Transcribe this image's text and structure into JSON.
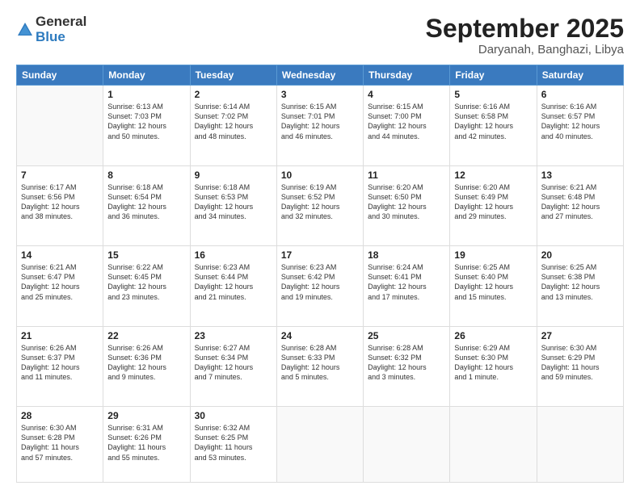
{
  "header": {
    "logo": {
      "general": "General",
      "blue": "Blue"
    },
    "title": "September 2025",
    "location": "Daryanah, Banghazi, Libya"
  },
  "calendar": {
    "weekdays": [
      "Sunday",
      "Monday",
      "Tuesday",
      "Wednesday",
      "Thursday",
      "Friday",
      "Saturday"
    ],
    "weeks": [
      [
        {
          "day": "",
          "info": ""
        },
        {
          "day": "1",
          "info": "Sunrise: 6:13 AM\nSunset: 7:03 PM\nDaylight: 12 hours\nand 50 minutes."
        },
        {
          "day": "2",
          "info": "Sunrise: 6:14 AM\nSunset: 7:02 PM\nDaylight: 12 hours\nand 48 minutes."
        },
        {
          "day": "3",
          "info": "Sunrise: 6:15 AM\nSunset: 7:01 PM\nDaylight: 12 hours\nand 46 minutes."
        },
        {
          "day": "4",
          "info": "Sunrise: 6:15 AM\nSunset: 7:00 PM\nDaylight: 12 hours\nand 44 minutes."
        },
        {
          "day": "5",
          "info": "Sunrise: 6:16 AM\nSunset: 6:58 PM\nDaylight: 12 hours\nand 42 minutes."
        },
        {
          "day": "6",
          "info": "Sunrise: 6:16 AM\nSunset: 6:57 PM\nDaylight: 12 hours\nand 40 minutes."
        }
      ],
      [
        {
          "day": "7",
          "info": "Sunrise: 6:17 AM\nSunset: 6:56 PM\nDaylight: 12 hours\nand 38 minutes."
        },
        {
          "day": "8",
          "info": "Sunrise: 6:18 AM\nSunset: 6:54 PM\nDaylight: 12 hours\nand 36 minutes."
        },
        {
          "day": "9",
          "info": "Sunrise: 6:18 AM\nSunset: 6:53 PM\nDaylight: 12 hours\nand 34 minutes."
        },
        {
          "day": "10",
          "info": "Sunrise: 6:19 AM\nSunset: 6:52 PM\nDaylight: 12 hours\nand 32 minutes."
        },
        {
          "day": "11",
          "info": "Sunrise: 6:20 AM\nSunset: 6:50 PM\nDaylight: 12 hours\nand 30 minutes."
        },
        {
          "day": "12",
          "info": "Sunrise: 6:20 AM\nSunset: 6:49 PM\nDaylight: 12 hours\nand 29 minutes."
        },
        {
          "day": "13",
          "info": "Sunrise: 6:21 AM\nSunset: 6:48 PM\nDaylight: 12 hours\nand 27 minutes."
        }
      ],
      [
        {
          "day": "14",
          "info": "Sunrise: 6:21 AM\nSunset: 6:47 PM\nDaylight: 12 hours\nand 25 minutes."
        },
        {
          "day": "15",
          "info": "Sunrise: 6:22 AM\nSunset: 6:45 PM\nDaylight: 12 hours\nand 23 minutes."
        },
        {
          "day": "16",
          "info": "Sunrise: 6:23 AM\nSunset: 6:44 PM\nDaylight: 12 hours\nand 21 minutes."
        },
        {
          "day": "17",
          "info": "Sunrise: 6:23 AM\nSunset: 6:42 PM\nDaylight: 12 hours\nand 19 minutes."
        },
        {
          "day": "18",
          "info": "Sunrise: 6:24 AM\nSunset: 6:41 PM\nDaylight: 12 hours\nand 17 minutes."
        },
        {
          "day": "19",
          "info": "Sunrise: 6:25 AM\nSunset: 6:40 PM\nDaylight: 12 hours\nand 15 minutes."
        },
        {
          "day": "20",
          "info": "Sunrise: 6:25 AM\nSunset: 6:38 PM\nDaylight: 12 hours\nand 13 minutes."
        }
      ],
      [
        {
          "day": "21",
          "info": "Sunrise: 6:26 AM\nSunset: 6:37 PM\nDaylight: 12 hours\nand 11 minutes."
        },
        {
          "day": "22",
          "info": "Sunrise: 6:26 AM\nSunset: 6:36 PM\nDaylight: 12 hours\nand 9 minutes."
        },
        {
          "day": "23",
          "info": "Sunrise: 6:27 AM\nSunset: 6:34 PM\nDaylight: 12 hours\nand 7 minutes."
        },
        {
          "day": "24",
          "info": "Sunrise: 6:28 AM\nSunset: 6:33 PM\nDaylight: 12 hours\nand 5 minutes."
        },
        {
          "day": "25",
          "info": "Sunrise: 6:28 AM\nSunset: 6:32 PM\nDaylight: 12 hours\nand 3 minutes."
        },
        {
          "day": "26",
          "info": "Sunrise: 6:29 AM\nSunset: 6:30 PM\nDaylight: 12 hours\nand 1 minute."
        },
        {
          "day": "27",
          "info": "Sunrise: 6:30 AM\nSunset: 6:29 PM\nDaylight: 11 hours\nand 59 minutes."
        }
      ],
      [
        {
          "day": "28",
          "info": "Sunrise: 6:30 AM\nSunset: 6:28 PM\nDaylight: 11 hours\nand 57 minutes."
        },
        {
          "day": "29",
          "info": "Sunrise: 6:31 AM\nSunset: 6:26 PM\nDaylight: 11 hours\nand 55 minutes."
        },
        {
          "day": "30",
          "info": "Sunrise: 6:32 AM\nSunset: 6:25 PM\nDaylight: 11 hours\nand 53 minutes."
        },
        {
          "day": "",
          "info": ""
        },
        {
          "day": "",
          "info": ""
        },
        {
          "day": "",
          "info": ""
        },
        {
          "day": "",
          "info": ""
        }
      ]
    ]
  }
}
